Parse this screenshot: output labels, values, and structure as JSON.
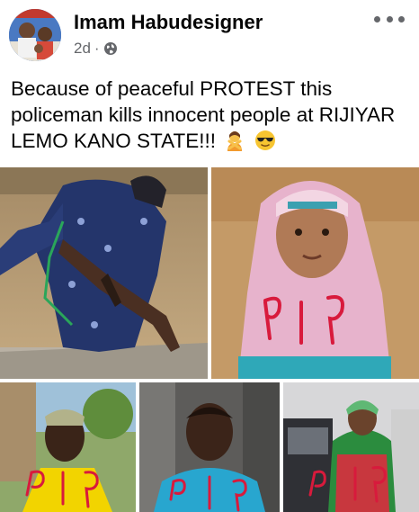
{
  "post": {
    "author": "Imam Habudesigner",
    "time": "2d",
    "separator": "·",
    "caption": "Because of peaceful PROTEST this policeman kills innocent people at RIJIYAR LEMO  KANO STATE!!!"
  },
  "photos": [
    {
      "label": "policeman-with-rifle"
    },
    {
      "label": "RIP"
    },
    {
      "label": "RIP"
    },
    {
      "label": "RIP"
    },
    {
      "label": "RIP"
    }
  ],
  "icons": [
    "more-options-icon",
    "globe-icon",
    "person-gesturing-no-emoji",
    "sunglasses-face-emoji"
  ]
}
